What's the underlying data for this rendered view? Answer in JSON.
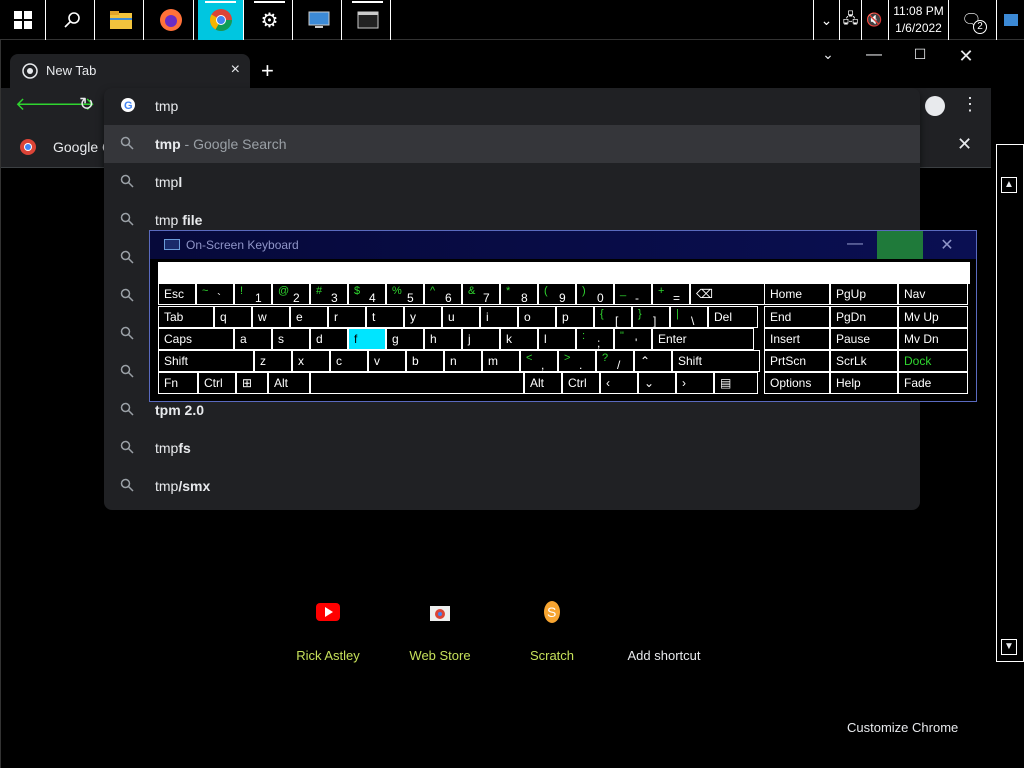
{
  "taskbar": {
    "clock_time": "11:08 PM",
    "clock_date": "1/6/2022",
    "notifications_count": "2",
    "colors": {
      "active": "#00c6e0"
    }
  },
  "browser": {
    "tab_title": "New Tab",
    "omnibox_text": "tmp",
    "bookmark_label": "Google C",
    "suggestions": [
      {
        "prefix": "tmp",
        "bold": "",
        "sub": " - Google Search"
      },
      {
        "prefix": "tmp",
        "bold": "l",
        "sub": ""
      },
      {
        "prefix": "tmp ",
        "bold": "file",
        "sub": ""
      },
      {
        "prefix": "",
        "bold": "",
        "sub": ""
      },
      {
        "prefix": "",
        "bold": "",
        "sub": ""
      },
      {
        "prefix": "",
        "bold": "",
        "sub": ""
      },
      {
        "prefix": "",
        "bold": "",
        "sub": ""
      },
      {
        "prefix": "",
        "bold": "tpm 2.0",
        "sub": ""
      },
      {
        "prefix": "tmp",
        "bold": "fs",
        "sub": ""
      },
      {
        "prefix": "tmp",
        "bold": "/smx",
        "sub": ""
      }
    ],
    "shortcuts": [
      {
        "label": "Rick Astley",
        "icon": "youtube-icon"
      },
      {
        "label": "Web Store",
        "icon": "web-store-icon"
      },
      {
        "label": "Scratch",
        "icon": "scratch-icon"
      },
      {
        "label": "Add shortcut",
        "icon": ""
      }
    ],
    "customize_label": "Customize Chrome"
  },
  "osk": {
    "title": "On-Screen Keyboard",
    "row1": [
      {
        "s": "",
        "m": "Esc"
      },
      {
        "s": "~",
        "m": "`"
      },
      {
        "s": "!",
        "m": "1"
      },
      {
        "s": "@",
        "m": "2"
      },
      {
        "s": "#",
        "m": "3"
      },
      {
        "s": "$",
        "m": "4"
      },
      {
        "s": "%",
        "m": "5"
      },
      {
        "s": "^",
        "m": "6"
      },
      {
        "s": "&",
        "m": "7"
      },
      {
        "s": "*",
        "m": "8"
      },
      {
        "s": "(",
        "m": "9"
      },
      {
        "s": ")",
        "m": "0"
      },
      {
        "s": "_",
        "m": "-"
      },
      {
        "s": "+",
        "m": "="
      }
    ],
    "row2": [
      "Tab",
      "q",
      "w",
      "e",
      "r",
      "t",
      "y",
      "u",
      "i",
      "o",
      "p"
    ],
    "row2_sym": [
      {
        "s": "{",
        "m": "["
      },
      {
        "s": "}",
        "m": "]"
      },
      {
        "s": "|",
        "m": "\\"
      }
    ],
    "del": "Del",
    "row3": [
      "Caps",
      "a",
      "s",
      "d",
      "f",
      "g",
      "h",
      "j",
      "k",
      "l"
    ],
    "row3_sym": [
      {
        "s": ":",
        "m": ";"
      },
      {
        "s": "\"",
        "m": "'"
      }
    ],
    "enter": "Enter",
    "row4": [
      "Shift",
      "z",
      "x",
      "c",
      "v",
      "b",
      "n",
      "m"
    ],
    "row4_sym": [
      {
        "s": "<",
        "m": ","
      },
      {
        "s": ">",
        "m": "."
      },
      {
        "s": "?",
        "m": "/"
      }
    ],
    "shift_r": "Shift",
    "row5": [
      "Fn",
      "Ctrl",
      "",
      "Alt",
      "",
      "Alt",
      "Ctrl"
    ],
    "nav_col1": [
      "Home",
      "End",
      "Insert",
      "PrtScn",
      "Options"
    ],
    "nav_col2": [
      "PgUp",
      "PgDn",
      "Pause",
      "ScrLk",
      "Help"
    ],
    "nav_col3": [
      "Nav",
      "Mv Up",
      "Mv Dn",
      "Dock",
      "Fade"
    ],
    "highlight_key": "f",
    "colors": {
      "highlight": "#00e5ff",
      "dock": "#2fd52f"
    }
  }
}
